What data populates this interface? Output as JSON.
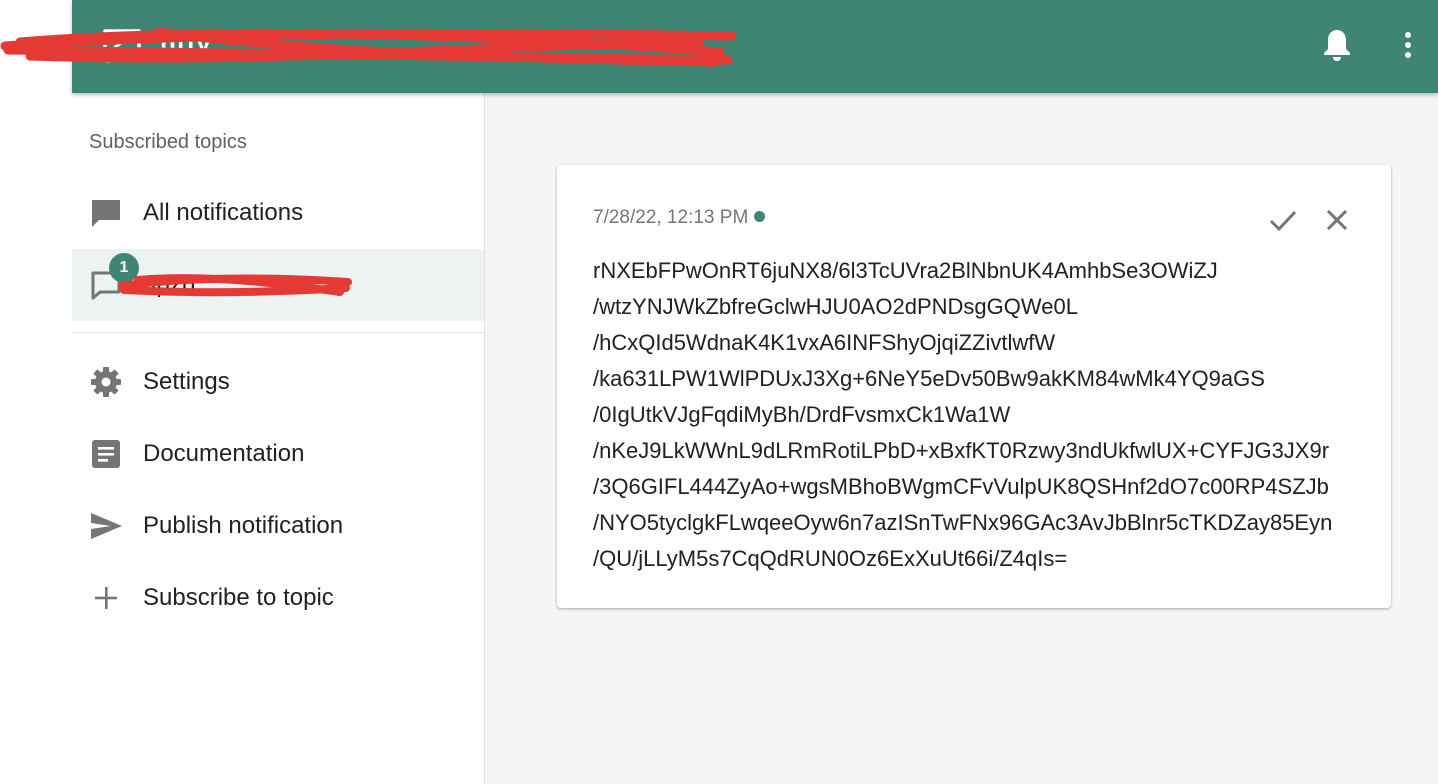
{
  "appbar": {
    "title": "ntfy",
    "icons": [
      "app-logo-icon",
      "bell-icon",
      "more-vert-icon"
    ],
    "color": "#3e8573"
  },
  "sidebar": {
    "heading": "Subscribed topics",
    "all_notifications": {
      "label": "All notifications",
      "icon": "chat-icon"
    },
    "topic": {
      "label": "upzb",
      "badge": "1",
      "icon": "chat-outline-icon"
    },
    "items": [
      {
        "label": "Settings",
        "icon": "gear-icon"
      },
      {
        "label": "Documentation",
        "icon": "document-icon"
      },
      {
        "label": "Publish notification",
        "icon": "send-icon"
      },
      {
        "label": "Subscribe to topic",
        "icon": "plus-icon"
      }
    ]
  },
  "notification": {
    "timestamp": "7/28/22, 12:13 PM",
    "lines": [
      "rNXEbFPwOnRT6juNX8/6l3TcUVra2BlNbnUK4AmhbSe3OWiZJ",
      "/wtzYNJWkZbfreGclwHJU0AO2dPNDsgGQWe0L",
      "/hCxQId5WdnaK4K1vxA6INFShyOjqiZZivtlwfW",
      "/ka631LPW1WlPDUxJ3Xg+6NeY5eDv50Bw9akKM84wMk4YQ9aGS",
      "/0IgUtkVJgFqdiMyBh/DrdFvsmxCk1Wa1W",
      "/nKeJ9LkWWnL9dLRmRotiLPbD+xBxfKT0Rzwy3ndUkfwlUX+CYFJG3JX9r",
      "/3Q6GIFL444ZyAo+wgsMBhoBWgmCFvVulpUK8QSHnf2dO7c00RP4SZJb",
      "/NYO5tyclgkFLwqeeOyw6n7azISnTwFNx96GAc3AvJbBlnr5cTKDZay85Eyn",
      "/QU/jLLyM5s7CqQdRUN0Oz6ExXuUt66i/Z4qIs="
    ]
  },
  "colors": {
    "accent": "#3e8573",
    "selected_bg": "#edf3f2",
    "redaction": "#e53935"
  }
}
